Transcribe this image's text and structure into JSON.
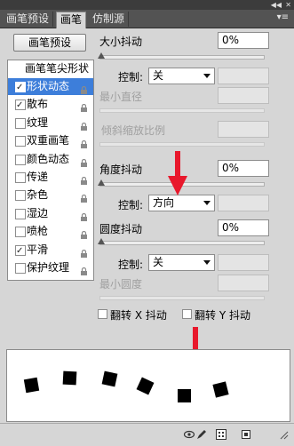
{
  "tabs": [
    {
      "label": "画笔预设",
      "active": false
    },
    {
      "label": "画笔",
      "active": true
    },
    {
      "label": "仿制源",
      "active": false
    }
  ],
  "window_controls": {
    "collapse": "◀◀",
    "close": "✕",
    "menu": "▾≡"
  },
  "presets_button": "画笔预设",
  "left_list": {
    "header": "画笔笔尖形状",
    "items": [
      {
        "label": "形状动态",
        "checked": true,
        "selected": true
      },
      {
        "label": "散布",
        "checked": true,
        "selected": false
      },
      {
        "label": "纹理",
        "checked": false,
        "selected": false
      },
      {
        "label": "双重画笔",
        "checked": false,
        "selected": false
      },
      {
        "label": "颜色动态",
        "checked": false,
        "selected": false
      },
      {
        "label": "传递",
        "checked": false,
        "selected": false
      },
      {
        "label": "杂色",
        "checked": false,
        "selected": false
      },
      {
        "label": "湿边",
        "checked": false,
        "selected": false
      },
      {
        "label": "喷枪",
        "checked": false,
        "selected": false
      },
      {
        "label": "平滑",
        "checked": true,
        "selected": false
      },
      {
        "label": "保护纹理",
        "checked": false,
        "selected": false
      }
    ]
  },
  "size_jitter": {
    "label": "大小抖动",
    "value": "0%",
    "control_label": "控制:",
    "control_value": "关"
  },
  "min_diameter": {
    "label": "最小直径"
  },
  "tilt_scale": {
    "label": "倾斜缩放比例"
  },
  "angle_jitter": {
    "label": "角度抖动",
    "value": "0%",
    "control_label": "控制:",
    "control_value": "方向"
  },
  "roundness_jitter": {
    "label": "圆度抖动",
    "value": "0%",
    "control_label": "控制:",
    "control_value": "关"
  },
  "min_roundness": {
    "label": "最小圆度"
  },
  "flip_x": {
    "label": "翻转 X 抖动",
    "checked": false
  },
  "flip_y": {
    "label": "翻转 Y 抖动",
    "checked": false
  },
  "colors": {
    "selection": "#3d7eda",
    "annotation_arrow": "#e8182c"
  }
}
